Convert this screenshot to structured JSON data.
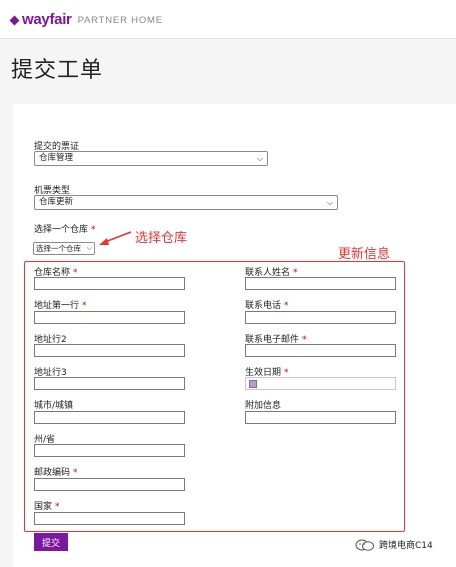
{
  "header": {
    "logo_text": "wayfair",
    "logo_sub": "PARTNER HOME"
  },
  "page": {
    "title": "提交工单"
  },
  "form": {
    "ticket_type_label": "提交的票证",
    "ticket_type_value": "仓库管理",
    "ticket_kind_label": "机票类型",
    "ticket_kind_value": "仓库更新",
    "warehouse_label": "选择一个仓库",
    "warehouse_value": "选择一个仓库",
    "required_mark": "*",
    "left_fields": [
      {
        "label": "仓库名称",
        "required": "*"
      },
      {
        "label": "地址第一行",
        "required": "*"
      },
      {
        "label": "地址行2",
        "required": ""
      },
      {
        "label": "地址行3",
        "required": ""
      },
      {
        "label": "城市/城镇",
        "required": ""
      },
      {
        "label": "州/省",
        "required": ""
      },
      {
        "label": "邮政编码",
        "required": "*"
      },
      {
        "label": "国家",
        "required": "*"
      }
    ],
    "right_fields": [
      {
        "label": "联系人姓名",
        "required": "*"
      },
      {
        "label": "联系电话",
        "required": "*"
      },
      {
        "label": "联系电子邮件",
        "required": "*"
      },
      {
        "label": "生效日期",
        "required": "*"
      },
      {
        "label": "附加信息",
        "required": ""
      }
    ],
    "submit_label": "提交"
  },
  "annotations": {
    "select_warehouse": "选择仓库",
    "update_info": "更新信息",
    "color": "#e33333"
  },
  "watermark": {
    "text": "跨境电商C14"
  },
  "colors": {
    "brand": "#7b189f",
    "required": "#cc0000"
  }
}
